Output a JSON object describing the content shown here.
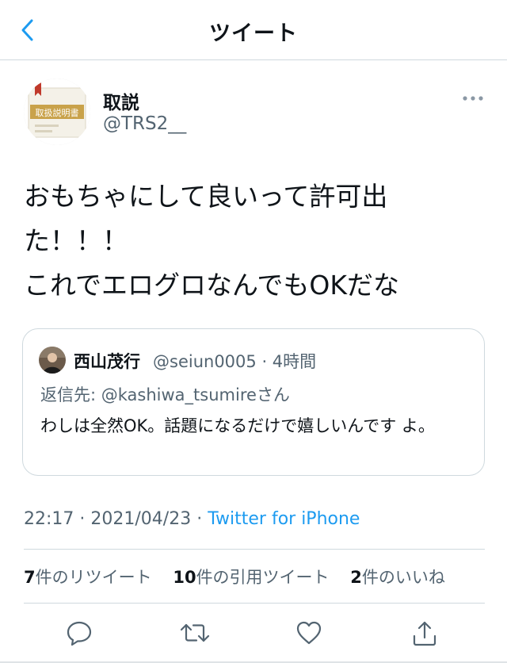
{
  "header": {
    "title": "ツイート"
  },
  "author": {
    "display_name": "取説",
    "handle": "@TRS2__",
    "avatar_text": "取扱説明書"
  },
  "tweet": {
    "lines": [
      "おもちゃにして良いって許可出",
      "た！！！",
      "これでエログロなんでもOKだな"
    ]
  },
  "quoted_tweet": {
    "author_name": "西山茂行",
    "author_handle": "@seiun0005",
    "time": "· 4時間",
    "reply_prefix": "返信先:",
    "reply_handle": "@kashiwa_tsumire",
    "reply_suffix": "さん",
    "text": "わしは全然OK。話題になるだけで嬉しいんです よ。"
  },
  "meta": {
    "time": "22:17",
    "sep1": "·",
    "date": "2021/04/23",
    "sep2": "·",
    "source": "Twitter for iPhone"
  },
  "stats": {
    "retweets_count": "7",
    "retweets_label": "件のリツイート",
    "quotes_count": "10",
    "quotes_label": "件の引用ツイート",
    "likes_count": "2",
    "likes_label": "件のいいね"
  },
  "icons": {
    "back": "chevron-left-icon",
    "more": "more-dots-icon",
    "reply": "reply-icon",
    "retweet": "retweet-icon",
    "like": "heart-icon",
    "share": "share-icon"
  },
  "colors": {
    "accent": "#1d9bf0",
    "secondary_text": "#536471",
    "divider": "#cfd9de",
    "avatar_bookmark": "#c0392b",
    "avatar_label": "#c9a24a"
  }
}
